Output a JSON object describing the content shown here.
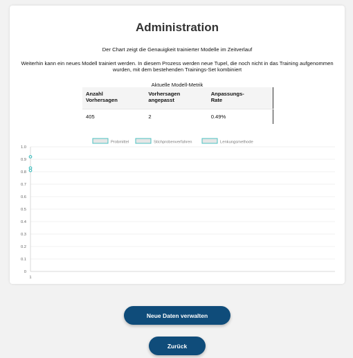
{
  "header": {
    "title": "Administration",
    "subtitle": "Der Chart zeigt die Genauigkeit trainierter Modelle im Zeitverlauf",
    "description": "Weiterhin kann ein neues Modell trainiert werden. In diesem Prozess werden neue Tupel, die noch nicht in das Training aufgenommen wurden, mit dem bestehenden Trainings-Set kombiniert"
  },
  "metrics": {
    "caption": "Aktuelle Modell-Metrik",
    "headers": {
      "count_line1": "Anzahl",
      "count_line2": "Vorhersagen",
      "adjusted_line1": "Vorhersagen",
      "adjusted_line2": "angepasst",
      "rate_line1": "Anpassungs-",
      "rate_line2": "Rate"
    },
    "values": {
      "count": "405",
      "adjusted": "2",
      "rate": "0.49%"
    }
  },
  "chart_data": {
    "type": "scatter",
    "title": "",
    "xlabel": "",
    "ylabel": "",
    "x": [
      "1"
    ],
    "xlim": [
      1,
      1
    ],
    "ylim": [
      0,
      1.0
    ],
    "yticks": [
      "0",
      "0.1",
      "0.2",
      "0.3",
      "0.4",
      "0.5",
      "0.6",
      "0.7",
      "0.8",
      "0.9",
      "1.0"
    ],
    "grid": true,
    "legend_position": "top",
    "series": [
      {
        "name": "Probmittel",
        "color": "#4bc0c0",
        "values": [
          0.92
        ]
      },
      {
        "name": "Stichprobenverfahren",
        "color": "#4bc0c0",
        "values": [
          0.83
        ]
      },
      {
        "name": "Lenkungsmethode",
        "color": "#4bc0c0",
        "values": [
          0.81
        ]
      }
    ]
  },
  "buttons": {
    "new_data": "Neue Daten verwalten",
    "back": "Zurück"
  },
  "colors": {
    "primary_button": "#0f4c7a",
    "series_color": "#4bc0c0",
    "background": "#f2f2f2"
  }
}
